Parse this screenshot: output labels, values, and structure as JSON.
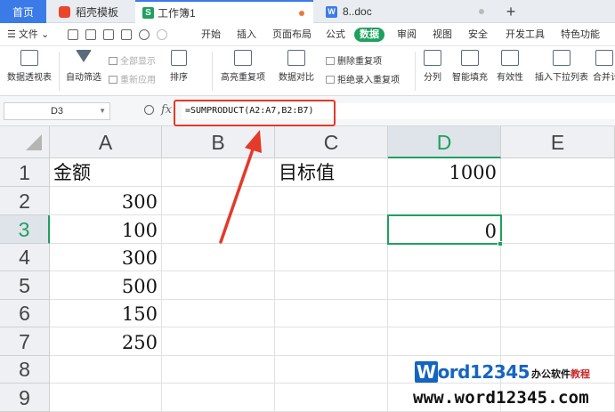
{
  "tabs": [
    {
      "label": "首页"
    },
    {
      "label": "稻壳模板"
    },
    {
      "label": "工作簿1",
      "icon": "S"
    },
    {
      "label": "8..doc",
      "icon": "W"
    }
  ],
  "menu": {
    "file": "☰ 文件 ⌄",
    "items": [
      "开始",
      "插入",
      "页面布局",
      "公式",
      "数据",
      "审阅",
      "视图",
      "安全",
      "开发工具",
      "特色功能"
    ],
    "active": "数据"
  },
  "ribbon": {
    "pivot": "数据透视表",
    "autofilter": "自动筛选",
    "show_all": "全部显示",
    "reapply": "重新应用",
    "sort": "排序",
    "highlight_dup": "高亮重复项",
    "compare": "数据对比",
    "delete_dup": "删除重复项",
    "reject_dup": "拒绝录入重复项",
    "split": "分列",
    "smart_fill": "智能填充",
    "validity": "有效性",
    "dropdown": "插入下拉列表",
    "merge": "合并计"
  },
  "formula_bar": {
    "name_box": "D3",
    "fx": "fx",
    "formula": "=SUMPRODUCT(A2:A7,B2:B7)"
  },
  "grid": {
    "columns": [
      "A",
      "B",
      "C",
      "D",
      "E"
    ],
    "rows": [
      "1",
      "2",
      "3",
      "4",
      "5",
      "6",
      "7",
      "8",
      "9"
    ],
    "selected_col": "D",
    "selected_row": "3",
    "cells": {
      "A1": "金额",
      "A2": "300",
      "A3": "100",
      "A4": "300",
      "A5": "500",
      "A6": "150",
      "A7": "250",
      "C1": "目标值",
      "D1": "1000",
      "D3": "0"
    }
  },
  "annotation": {
    "box_color": "#e33a2a",
    "arrow_color": "#e33a2a"
  },
  "watermark": {
    "brand_letter": "W",
    "brand_rest": "ord",
    "brand_digits": "12345",
    "tagline_black": "办公软件",
    "tagline_red": "教程",
    "url": "www.word12345.com"
  }
}
